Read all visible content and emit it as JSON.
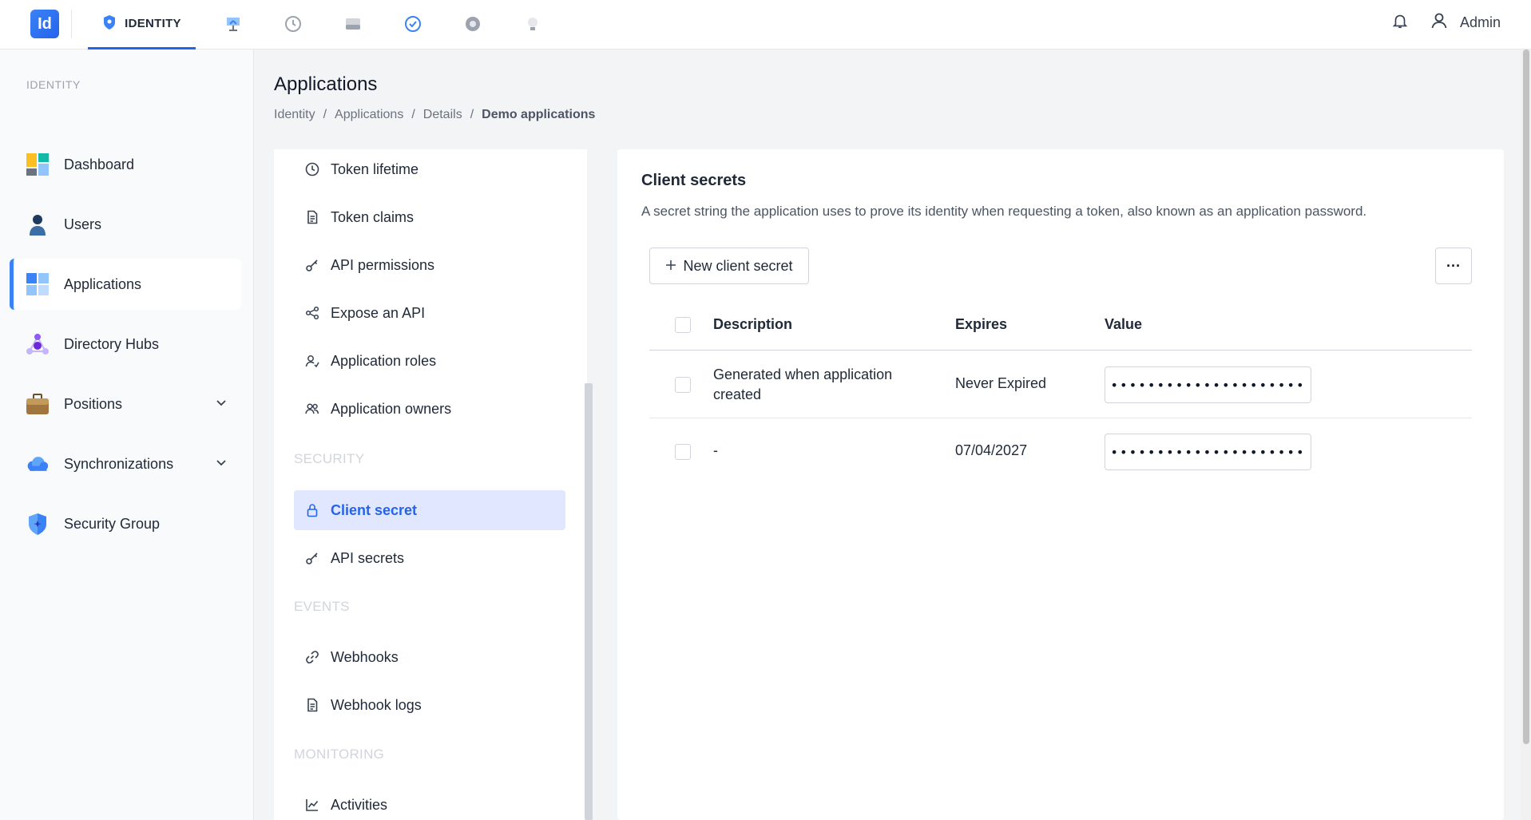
{
  "topbar": {
    "logo_text": "Id",
    "active_module": "IDENTITY",
    "module_icons": [
      "monitor-icon",
      "history-icon",
      "storage-icon",
      "check-badge-icon",
      "settings-icon",
      "lightbulb-icon"
    ],
    "user_name": "Admin"
  },
  "sidebar": {
    "heading": "IDENTITY",
    "items": [
      {
        "label": "Dashboard",
        "icon": "dashboard-icon"
      },
      {
        "label": "Users",
        "icon": "user-icon"
      },
      {
        "label": "Applications",
        "icon": "apps-icon",
        "active": true
      },
      {
        "label": "Directory Hubs",
        "icon": "hub-icon"
      },
      {
        "label": "Positions",
        "icon": "briefcase-icon",
        "expandable": true
      },
      {
        "label": "Synchronizations",
        "icon": "cloud-sync-icon",
        "expandable": true
      },
      {
        "label": "Security Group",
        "icon": "shield-icon"
      }
    ]
  },
  "page": {
    "title": "Applications",
    "breadcrumb": [
      "Identity",
      "Applications",
      "Details",
      "Demo applications"
    ],
    "breadcrumb_sep": "/"
  },
  "submenu": {
    "items_top": [
      "Token lifetime",
      "Token claims",
      "API permissions",
      "Expose an API",
      "Application roles",
      "Application owners"
    ],
    "security_heading": "SECURITY",
    "security_items": [
      "Client secret",
      "API secrets"
    ],
    "events_heading": "EVENTS",
    "events_items": [
      "Webhooks",
      "Webhook logs"
    ],
    "monitoring_heading": "MONITORING",
    "monitoring_items": [
      "Activities"
    ]
  },
  "content": {
    "title": "Client secrets",
    "description": "A secret string the application uses to prove its identity when requesting a token, also known as an application password.",
    "new_button_label": "New client secret",
    "more_button_label": "···",
    "columns": [
      "Description",
      "Expires",
      "Value"
    ],
    "rows": [
      {
        "description_line1": "Generated when application",
        "description_line2": "created",
        "expires": "Never Expired",
        "value": "•••••••••••••••••••••"
      },
      {
        "description_line1": "-",
        "description_line2": "",
        "expires": "07/04/2027",
        "value": "•••••••••••••••••••••"
      }
    ]
  },
  "colors": {
    "accent": "#2563eb",
    "active_submenu_bg": "#e0e7ff"
  }
}
